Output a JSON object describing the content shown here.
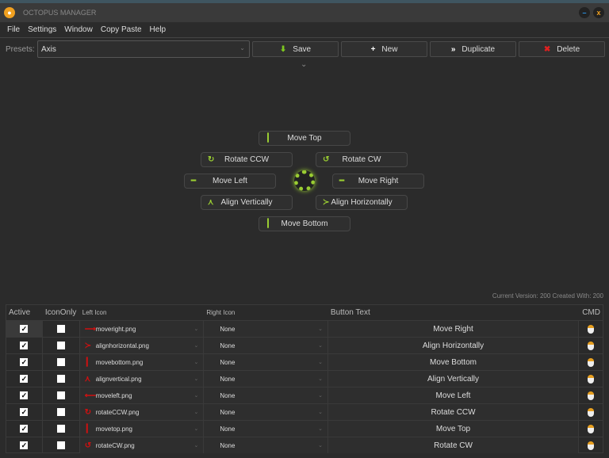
{
  "app": {
    "title": "OCTOPUS MANAGER",
    "minimize": "–",
    "close": "x"
  },
  "menu": [
    "File",
    "Settings",
    "Window",
    "Copy Paste",
    "Help"
  ],
  "presets": {
    "label": "Presets:",
    "value": "Axis"
  },
  "toolbar": [
    {
      "label": "Save",
      "icon": "⬇",
      "color": "#7ec820"
    },
    {
      "label": "New",
      "icon": "+",
      "color": "#ffffff"
    },
    {
      "label": "Duplicate",
      "icon": "»",
      "color": "#ffffff"
    },
    {
      "label": "Delete",
      "icon": "✖",
      "color": "#e02020"
    }
  ],
  "pie": [
    {
      "label": "Move Top",
      "icon": "┃"
    },
    {
      "label": "Rotate CCW",
      "icon": "↻"
    },
    {
      "label": "Rotate CW",
      "icon": "↺"
    },
    {
      "label": "Move Left",
      "icon": "━"
    },
    {
      "label": "Move Right",
      "icon": "━"
    },
    {
      "label": "Align Vertically",
      "icon": "⋏"
    },
    {
      "label": "Align Horizontally",
      "icon": "≻"
    },
    {
      "label": "Move Bottom",
      "icon": "┃"
    }
  ],
  "version": "Current Version: 200   Created With: 200",
  "table": {
    "headers": [
      "Active",
      "IconOnly",
      "Left Icon",
      "Right Icon",
      "Button Text",
      "CMD"
    ],
    "rows": [
      {
        "active": true,
        "icon_only": false,
        "left_icon": "moveright.png",
        "glyph": "⟶",
        "right_icon": "None",
        "text": "Move Right"
      },
      {
        "active": true,
        "icon_only": false,
        "left_icon": "alignhorizontal.png",
        "glyph": "≻",
        "right_icon": "None",
        "text": "Align Horizontally"
      },
      {
        "active": true,
        "icon_only": false,
        "left_icon": "movebottom.png",
        "glyph": "┃",
        "right_icon": "None",
        "text": "Move Bottom"
      },
      {
        "active": true,
        "icon_only": false,
        "left_icon": "alignvertical.png",
        "glyph": "⋏",
        "right_icon": "None",
        "text": "Align Vertically"
      },
      {
        "active": true,
        "icon_only": false,
        "left_icon": "moveleft.png",
        "glyph": "⟵",
        "right_icon": "None",
        "text": "Move Left"
      },
      {
        "active": true,
        "icon_only": false,
        "left_icon": "rotateCCW.png",
        "glyph": "↻",
        "right_icon": "None",
        "text": "Rotate CCW"
      },
      {
        "active": true,
        "icon_only": false,
        "left_icon": "movetop.png",
        "glyph": "┃",
        "right_icon": "None",
        "text": "Move Top"
      },
      {
        "active": true,
        "icon_only": false,
        "left_icon": "rotateCW.png",
        "glyph": "↺",
        "right_icon": "None",
        "text": "Rotate CW"
      }
    ]
  },
  "colors": {
    "accent": "#9acd32",
    "icon_red": "#d01010"
  }
}
